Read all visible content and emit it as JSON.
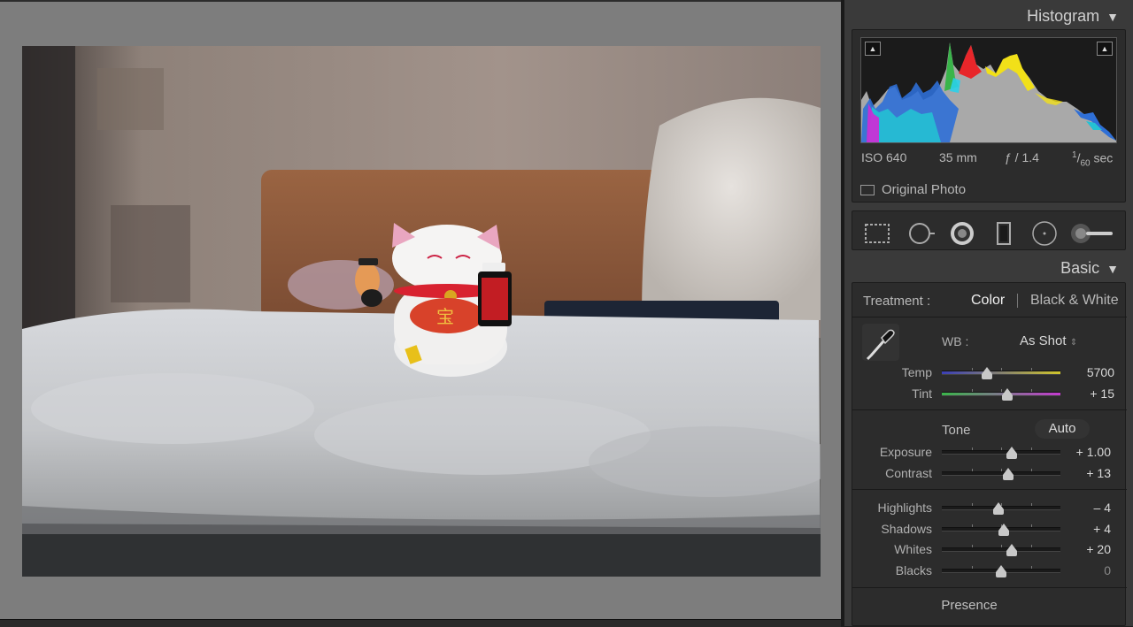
{
  "histogram": {
    "title": "Histogram",
    "exif": {
      "iso": "ISO 640",
      "focal": "35 mm",
      "aperture": "ƒ / 1.4",
      "shutter_num": "1",
      "shutter_den": "60",
      "shutter_unit": "sec"
    },
    "original_photo_label": "Original Photo"
  },
  "tools": [
    "crop-overlay-icon",
    "spot-removal-icon",
    "red-eye-icon",
    "graduated-filter-icon",
    "radial-filter-icon",
    "adjustment-brush-icon"
  ],
  "basic": {
    "title": "Basic",
    "treatment_label": "Treatment :",
    "treatment_color": "Color",
    "treatment_bw": "Black & White",
    "wb_label": "WB :",
    "wb_value": "As Shot",
    "tone_label": "Tone",
    "auto_label": "Auto",
    "presence_label": "Presence",
    "sliders": {
      "temp": {
        "label": "Temp",
        "value": "5700",
        "level": 0.38
      },
      "tint": {
        "label": "Tint",
        "value": "+ 15",
        "level": 0.55
      },
      "exposure": {
        "label": "Exposure",
        "value": "+ 1.00",
        "level": 0.59
      },
      "contrast": {
        "label": "Contrast",
        "value": "+ 13",
        "level": 0.56
      },
      "highlights": {
        "label": "Highlights",
        "value": "– 4",
        "level": 0.48
      },
      "shadows": {
        "label": "Shadows",
        "value": "+ 4",
        "level": 0.52
      },
      "whites": {
        "label": "Whites",
        "value": "+ 20",
        "level": 0.59
      },
      "blacks": {
        "label": "Blacks",
        "value": "0",
        "level": 0.5
      }
    }
  },
  "colors": {
    "panel_bg": "#3a3a3a",
    "box_bg": "#2c2c2c",
    "canvas_bg": "#7d7d7d"
  }
}
